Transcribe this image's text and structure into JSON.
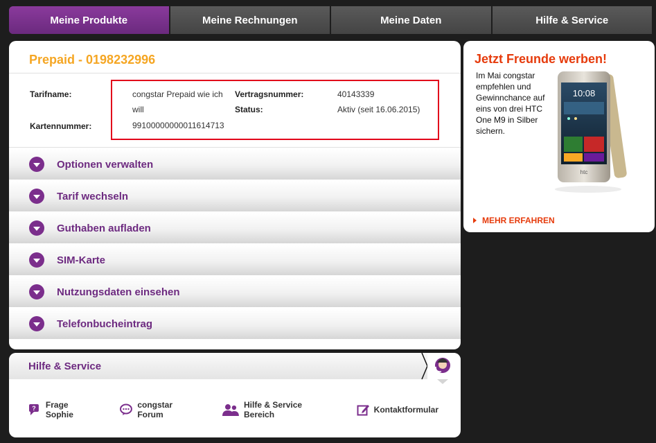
{
  "nav": {
    "tabs": [
      {
        "label": "Meine Produkte",
        "active": true
      },
      {
        "label": "Meine Rechnungen",
        "active": false
      },
      {
        "label": "Meine Daten",
        "active": false
      },
      {
        "label": "Hilfe & Service",
        "active": false
      }
    ]
  },
  "product": {
    "title": "Prepaid - 0198232996",
    "tarifname_label": "Tarifname:",
    "tarifname_line1": "congstar Prepaid wie ich",
    "tarifname_line2": "will",
    "vertragsnummer_label": "Vertragsnummer:",
    "vertragsnummer_value": "40143339",
    "status_label": "Status:",
    "status_value": "Aktiv (seit 16.06.2015)",
    "kartennummer_label": "Kartennummer:",
    "kartennummer_value": "99100000000011614713"
  },
  "accordion": [
    {
      "label": "Optionen verwalten"
    },
    {
      "label": "Tarif wechseln"
    },
    {
      "label": "Guthaben aufladen"
    },
    {
      "label": "SIM-Karte"
    },
    {
      "label": "Nutzungsdaten einsehen"
    },
    {
      "label": "Telefonbucheintrag"
    }
  ],
  "promo": {
    "title": "Jetzt Freunde werben!",
    "text": "Im Mai congstar empfehlen und Gewinnchance auf eins von drei HTC One M9 in Silber sichern.",
    "link": "MEHR ERFAHREN",
    "phone_time": "10:08",
    "phone_brand": "htc"
  },
  "help": {
    "title": "Hilfe & Service",
    "links": [
      {
        "label": "Frage Sophie",
        "icon": "chat-question-icon"
      },
      {
        "label": "congstar Forum",
        "icon": "forum-bubble-icon"
      },
      {
        "label": "Hilfe & Service Bereich",
        "icon": "users-icon"
      },
      {
        "label": "Kontaktformular",
        "icon": "edit-form-icon"
      }
    ]
  },
  "colors": {
    "accent_purple": "#7b2e8c",
    "orange_title": "#f5a623",
    "promo_red": "#e63b0c",
    "highlight_box": "#e2001a"
  }
}
